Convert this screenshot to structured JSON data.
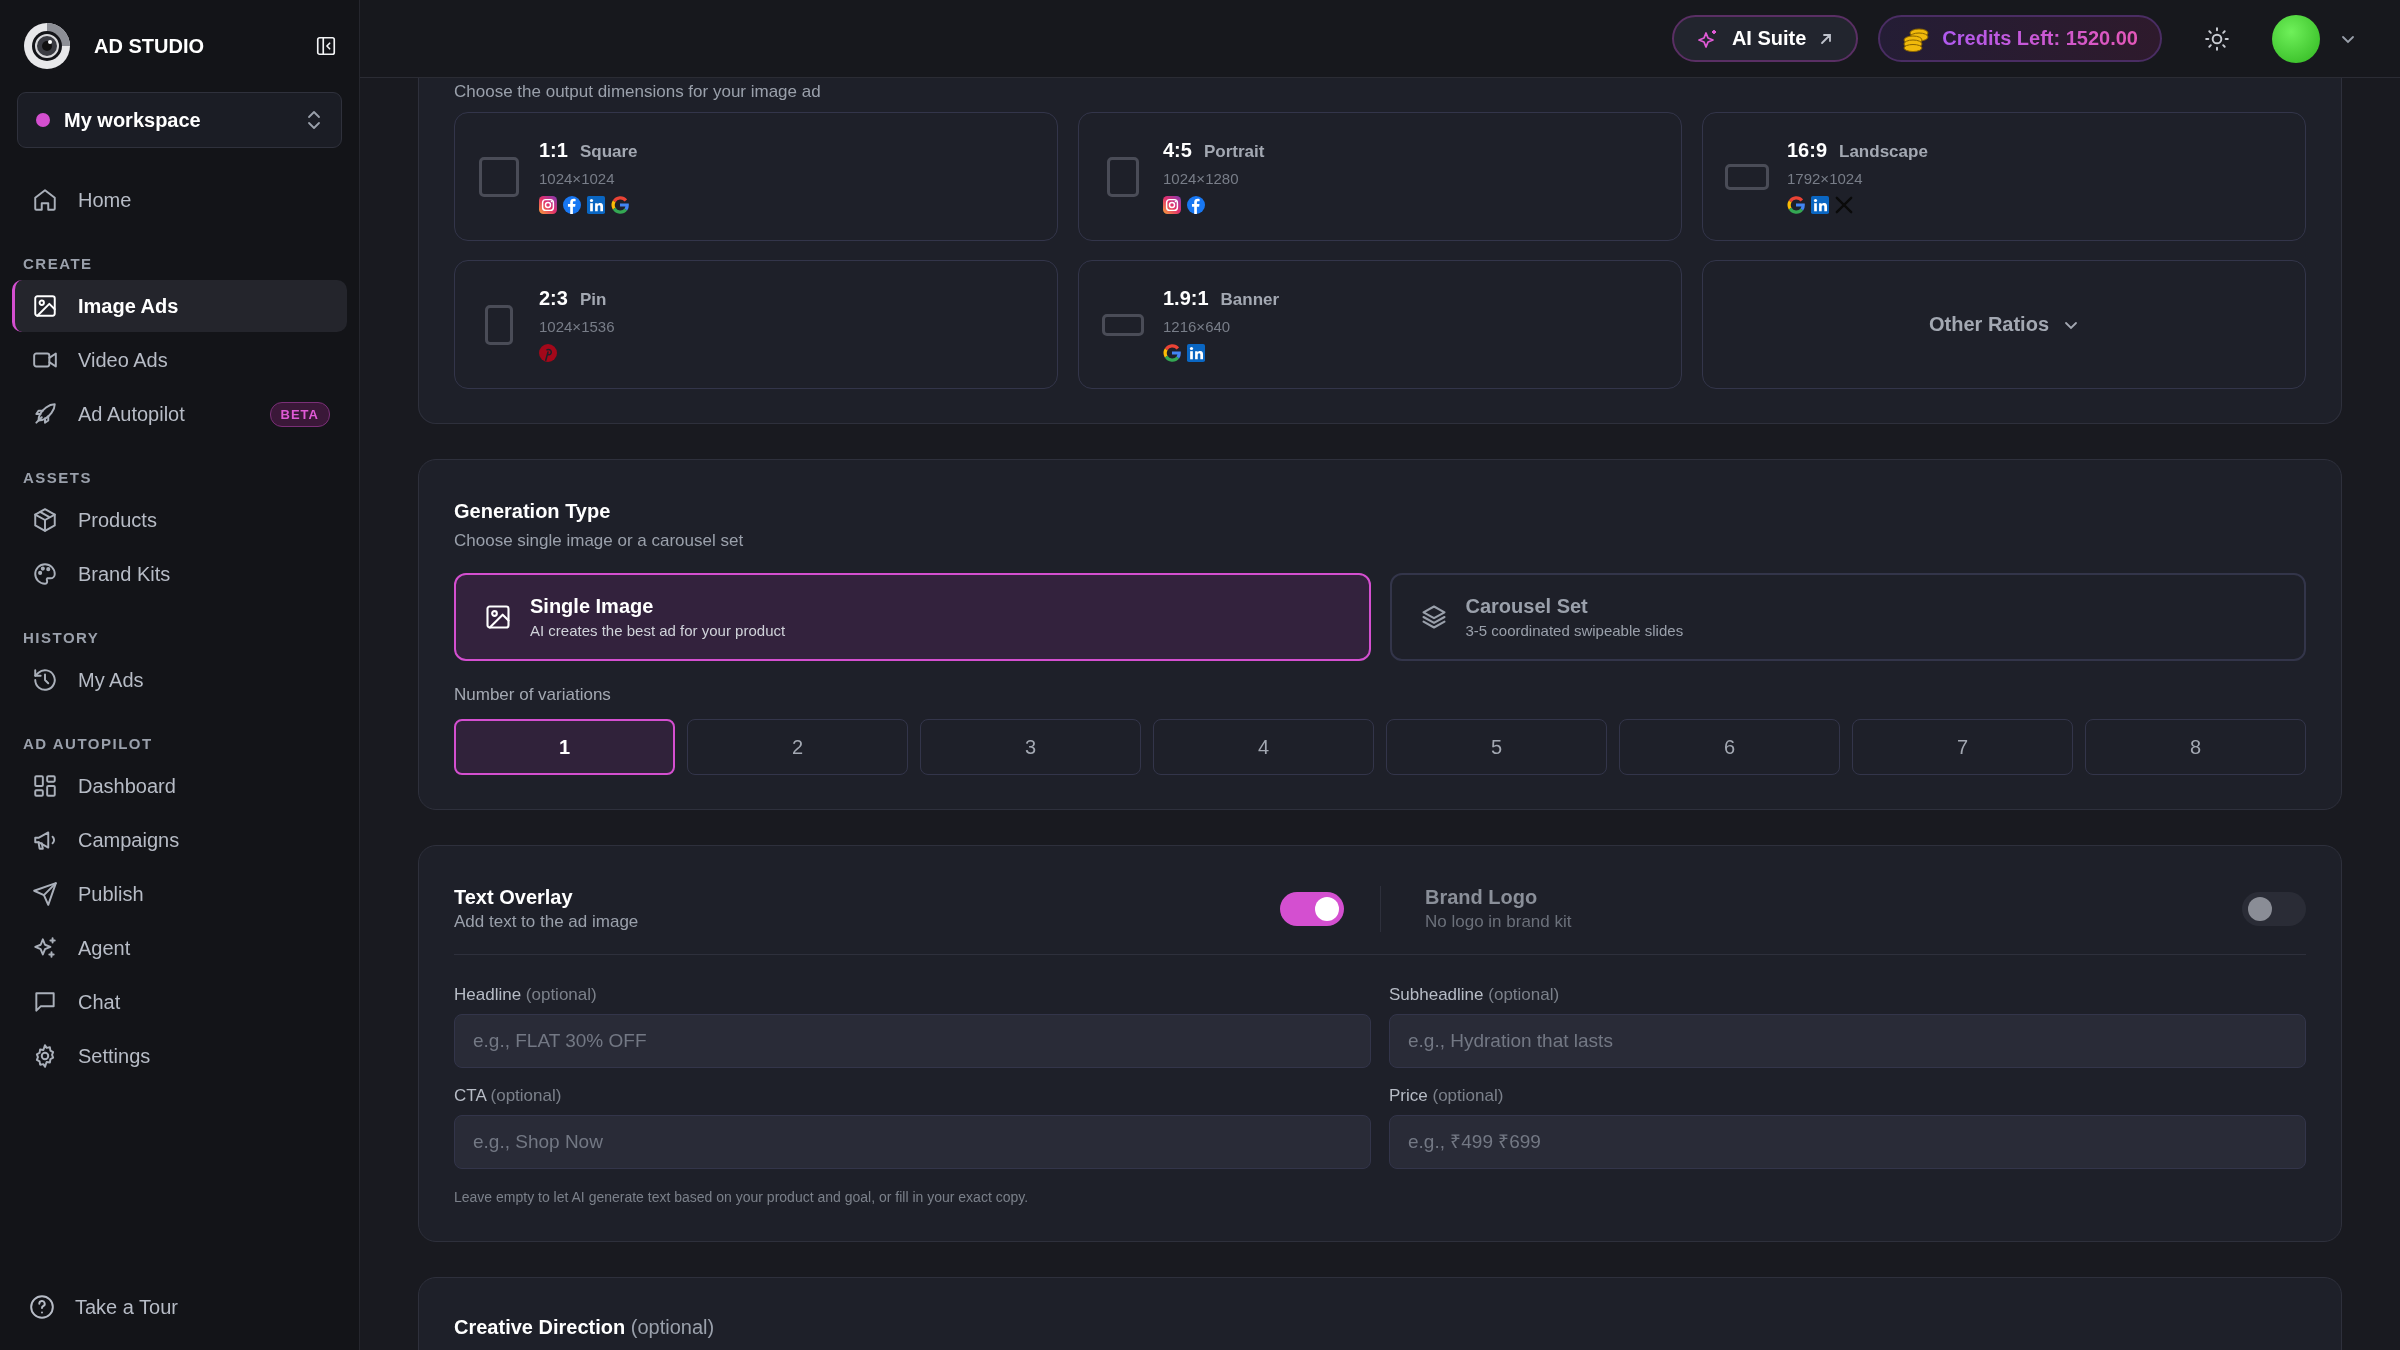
{
  "sidebar": {
    "brand": "AD STUDIO",
    "workspace": {
      "name": "My workspace",
      "color": "#d44fd0"
    },
    "sections": [
      {
        "items": [
          {
            "label": "Home",
            "selected": false
          }
        ]
      },
      {
        "heading": "CREATE",
        "items": [
          {
            "label": "Image Ads",
            "selected": true
          },
          {
            "label": "Video Ads",
            "selected": false
          },
          {
            "label": "Ad Autopilot",
            "selected": false,
            "badge": "BETA"
          }
        ]
      },
      {
        "heading": "ASSETS",
        "items": [
          {
            "label": "Products",
            "selected": false
          },
          {
            "label": "Brand Kits",
            "selected": false
          }
        ]
      },
      {
        "heading": "HISTORY",
        "items": [
          {
            "label": "My Ads",
            "selected": false
          }
        ]
      },
      {
        "heading": "AD AUTOPILOT",
        "items": [
          {
            "label": "Dashboard",
            "selected": false
          },
          {
            "label": "Campaigns",
            "selected": false
          },
          {
            "label": "Publish",
            "selected": false
          },
          {
            "label": "Agent",
            "selected": false
          },
          {
            "label": "Chat",
            "selected": false
          },
          {
            "label": "Settings",
            "selected": false
          }
        ]
      }
    ],
    "footer": {
      "label": "Take a Tour"
    }
  },
  "topbar": {
    "ai_suite": "AI Suite",
    "credits": "Credits Left: 1520.00"
  },
  "aspect": {
    "subtitle": "Choose the output dimensions for your image ad",
    "options": [
      {
        "ratio": "1:1",
        "name": "Square",
        "size": "1024×1024",
        "kind": "square",
        "selected": false,
        "platforms": [
          {
            "kind": "instagram"
          },
          {
            "kind": "facebook"
          },
          {
            "kind": "linkedin"
          },
          {
            "kind": "google"
          }
        ]
      },
      {
        "ratio": "4:5",
        "name": "Portrait",
        "size": "1024×1280",
        "kind": "portrait",
        "selected": false,
        "platforms": [
          {
            "kind": "instagram"
          },
          {
            "kind": "facebook"
          }
        ]
      },
      {
        "ratio": "16:9",
        "name": "Landscape",
        "size": "1792×1024",
        "kind": "landscape",
        "selected": false,
        "platforms": [
          {
            "kind": "google"
          },
          {
            "kind": "linkedin"
          },
          {
            "kind": "x"
          }
        ]
      },
      {
        "ratio": "2:3",
        "name": "Pin",
        "size": "1024×1536",
        "kind": "tall",
        "selected": false,
        "platforms": [
          {
            "kind": "pinterest"
          }
        ]
      },
      {
        "ratio": "1.9:1",
        "name": "Banner",
        "size": "1216×640",
        "kind": "wide",
        "selected": false,
        "platforms": [
          {
            "kind": "google"
          },
          {
            "kind": "linkedin"
          }
        ]
      }
    ],
    "more": "Other Ratios"
  },
  "generation": {
    "title": "Generation Type",
    "subtitle": "Choose single image or a carousel set",
    "options": [
      {
        "title": "Single Image",
        "subtitle": "AI creates the best ad for your product",
        "selected": true
      },
      {
        "title": "Carousel Set",
        "subtitle": "3-5 coordinated swipeable slides",
        "selected": false
      }
    ],
    "variations_label": "Number of variations",
    "variations": [
      {
        "label": "1",
        "selected": true
      },
      {
        "label": "2",
        "selected": false
      },
      {
        "label": "3",
        "selected": false
      },
      {
        "label": "4",
        "selected": false
      },
      {
        "label": "5",
        "selected": false
      },
      {
        "label": "6",
        "selected": false
      },
      {
        "label": "7",
        "selected": false
      },
      {
        "label": "8",
        "selected": false
      }
    ]
  },
  "overlay": {
    "toggles": [
      {
        "title": "Text Overlay",
        "subtitle": "Add text to the ad image",
        "on": true,
        "disabled": false
      },
      {
        "title": "Brand Logo",
        "subtitle": "No logo in brand kit",
        "on": false,
        "disabled": true
      }
    ],
    "fields": [
      {
        "label": "Headline",
        "note": "(optional)",
        "placeholder": "e.g., FLAT 30% OFF"
      },
      {
        "label": "Subheadline",
        "note": "(optional)",
        "placeholder": "e.g., Hydration that lasts"
      },
      {
        "label": "CTA",
        "note": "(optional)",
        "placeholder": "e.g., Shop Now"
      },
      {
        "label": "Price",
        "note": "(optional)",
        "placeholder": "e.g., ₹499 ₹699"
      }
    ],
    "hint": "Leave empty to let AI generate text based on your product and goal, or fill in your exact copy."
  },
  "creative": {
    "title": "Creative Direction",
    "note": "(optional)"
  }
}
